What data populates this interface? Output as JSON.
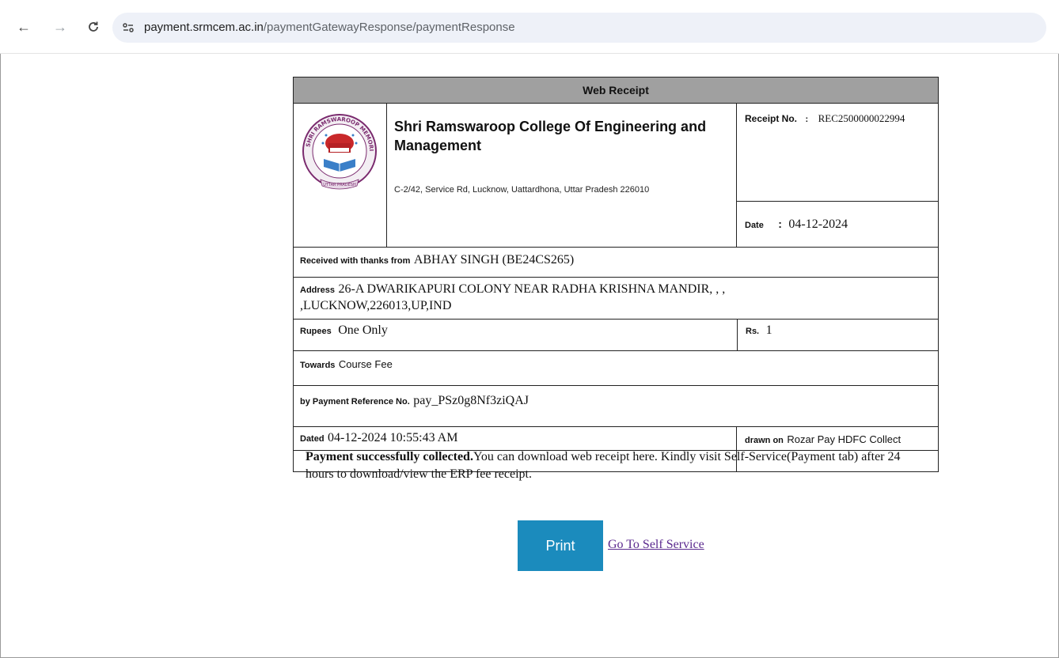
{
  "browser": {
    "url_host": "payment.srmcem.ac.in",
    "url_path": "/paymentGatewayResponse/paymentResponse"
  },
  "receipt": {
    "header": "Web Receipt",
    "college_name": "Shri Ramswaroop College Of Engineering and Management",
    "college_address": "C-2/42, Service Rd, Lucknow, Uattardhona, Uttar Pradesh 226010",
    "receipt_no_label": "Receipt No.",
    "receipt_no_sep": ":",
    "receipt_no": "REC2500000022994",
    "date_label": "Date",
    "date_sep": ":",
    "date": "04-12-2024",
    "received_label": "Received with thanks from",
    "received_from": "ABHAY SINGH (BE24CS265)",
    "address_label": "Address",
    "address_line1": "26-A DWARIKAPURI COLONY NEAR RADHA KRISHNA MANDIR, , ,",
    "address_line2": ",LUCKNOW,226013,UP,IND",
    "rupees_label": "Rupees",
    "rupees_words": "One Only",
    "rs_label": "Rs.",
    "rs_amount": "1",
    "towards_label": "Towards",
    "towards": "Course Fee",
    "payref_label": "by Payment Reference No.",
    "payref": "pay_PSz0g8Nf3ziQAJ",
    "dated_label": "Dated",
    "dated": "04-12-2024 10:55:43 AM",
    "drawn_label": "drawn on",
    "drawn_on": "Rozar Pay HDFC Collect"
  },
  "logo": {
    "arc_text": "SHRI RAMSWAROOP MEMORIAL UNIVERSITY",
    "banner_text": "UTTAR PRADESH",
    "colors": {
      "ring": "#7a2a6e",
      "pot": "#c8282a",
      "book": "#3a7fc8"
    }
  },
  "message": {
    "bold": "Payment successfully collected.",
    "text": "You can download web receipt here. Kindly visit Self-Service(Payment tab) after 24 hours to download/view the ERP fee receipt."
  },
  "actions": {
    "print_label": "Print",
    "self_service_label": "Go To Self Service"
  }
}
